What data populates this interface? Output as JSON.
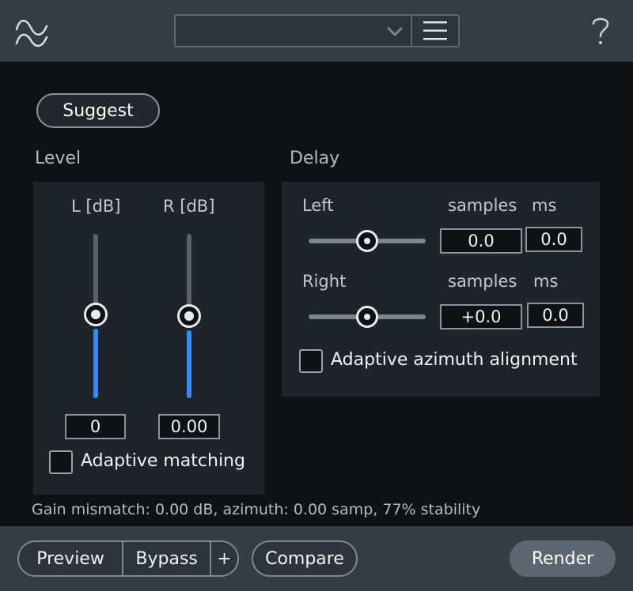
{
  "header": {
    "logo_icon": "waveform-logo-icon",
    "preset_value": "",
    "preset_dropdown_icon": "chevron-down-icon",
    "preset_menu_icon": "hamburger-menu-icon",
    "help_icon": "question-mark-icon"
  },
  "suggest_label": "Suggest",
  "level": {
    "label": "Level",
    "left_label": "L [dB]",
    "right_label": "R [dB]",
    "left_value": "0",
    "right_value": "0.00",
    "adaptive_matching_label": "Adaptive matching",
    "adaptive_matching_checked": false
  },
  "delay": {
    "label": "Delay",
    "left_label": "Left",
    "right_label": "Right",
    "samples_label": "samples",
    "ms_label": "ms",
    "left_samples": "0.0",
    "left_ms": "0.0",
    "right_samples": "+0.0",
    "right_ms": "0.0",
    "adaptive_azimuth_label": "Adaptive azimuth alignment",
    "adaptive_azimuth_checked": false
  },
  "status_text": "Gain mismatch: 0.00 dB, azimuth: 0.00 samp, 77% stability",
  "footer": {
    "preview_label": "Preview",
    "bypass_label": "Bypass",
    "plus_label": "+",
    "compare_label": "Compare",
    "render_label": "Render"
  },
  "colors": {
    "accent_blue": "#2f8cff",
    "bar_bg": "#343c46",
    "panel_bg": "#1f242a",
    "main_bg": "#0f1114"
  }
}
